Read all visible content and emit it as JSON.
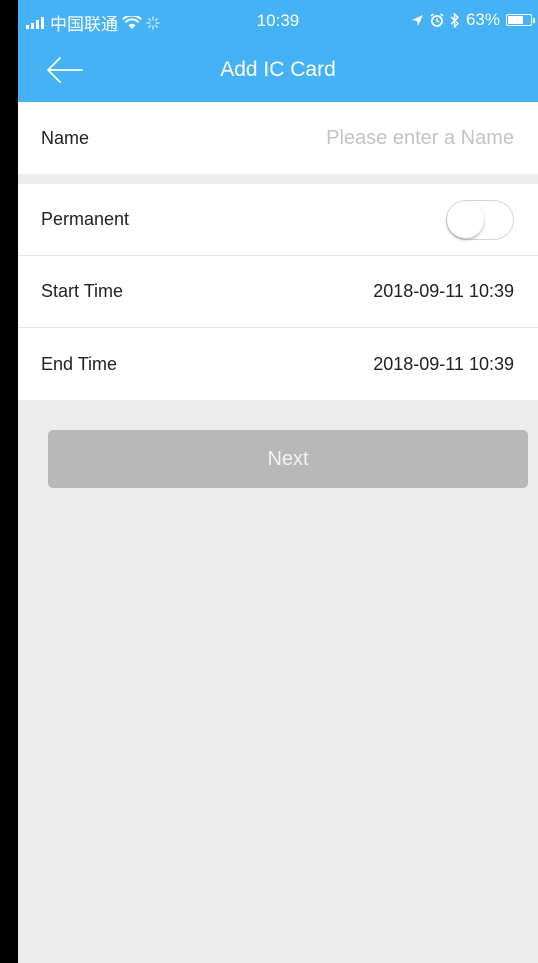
{
  "status_bar": {
    "carrier": "中国联通",
    "time": "10:39",
    "battery": "63%"
  },
  "nav": {
    "title": "Add IC Card"
  },
  "form": {
    "name_label": "Name",
    "name_placeholder": "Please enter a Name",
    "permanent_label": "Permanent",
    "permanent_on": false,
    "start_label": "Start Time",
    "start_value": "2018-09-11 10:39",
    "end_label": "End Time",
    "end_value": "2018-09-11 10:39"
  },
  "actions": {
    "next_label": "Next"
  },
  "colors": {
    "header": "#45b2f5",
    "button_disabled": "#b8b8b8",
    "background": "#ececec"
  }
}
